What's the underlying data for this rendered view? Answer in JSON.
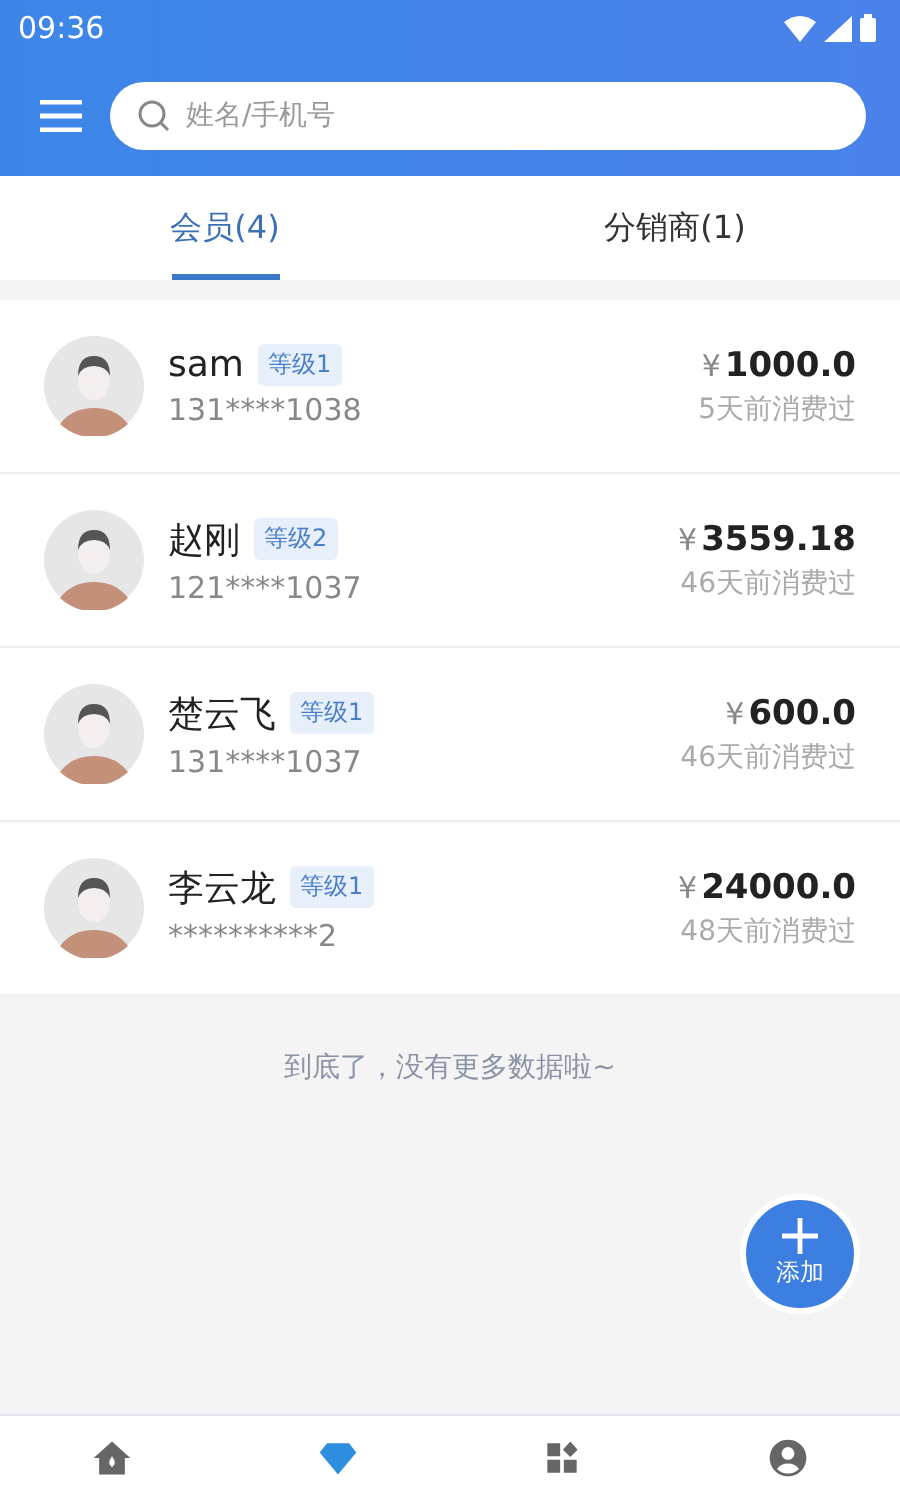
{
  "status_bar": {
    "time": "09:36"
  },
  "search": {
    "placeholder": "姓名/手机号"
  },
  "tabs": [
    {
      "label": "会员(4)",
      "selected": true
    },
    {
      "label": "分销商(1)",
      "selected": false
    }
  ],
  "members": [
    {
      "name": "sam",
      "level_tag": "等级1",
      "phone": "131****1038",
      "currency": "¥",
      "amount": "1000.0",
      "last_visit": "5天前消费过"
    },
    {
      "name": "赵刚",
      "level_tag": "等级2",
      "phone": "121****1037",
      "currency": "¥",
      "amount": "3559.18",
      "last_visit": "46天前消费过"
    },
    {
      "name": "楚云飞",
      "level_tag": "等级1",
      "phone": "131****1037",
      "currency": "¥",
      "amount": "600.0",
      "last_visit": "46天前消费过"
    },
    {
      "name": "李云龙",
      "level_tag": "等级1",
      "phone": "**********2",
      "currency": "¥",
      "amount": "24000.0",
      "last_visit": "48天前消费过"
    }
  ],
  "end_message": "到底了，没有更多数据啦~",
  "add_button": {
    "label": "添加"
  },
  "bottom_nav": [
    {
      "kind": "home",
      "selected": false
    },
    {
      "kind": "diamond",
      "selected": true
    },
    {
      "kind": "grid",
      "selected": false
    },
    {
      "kind": "person",
      "selected": false
    }
  ]
}
